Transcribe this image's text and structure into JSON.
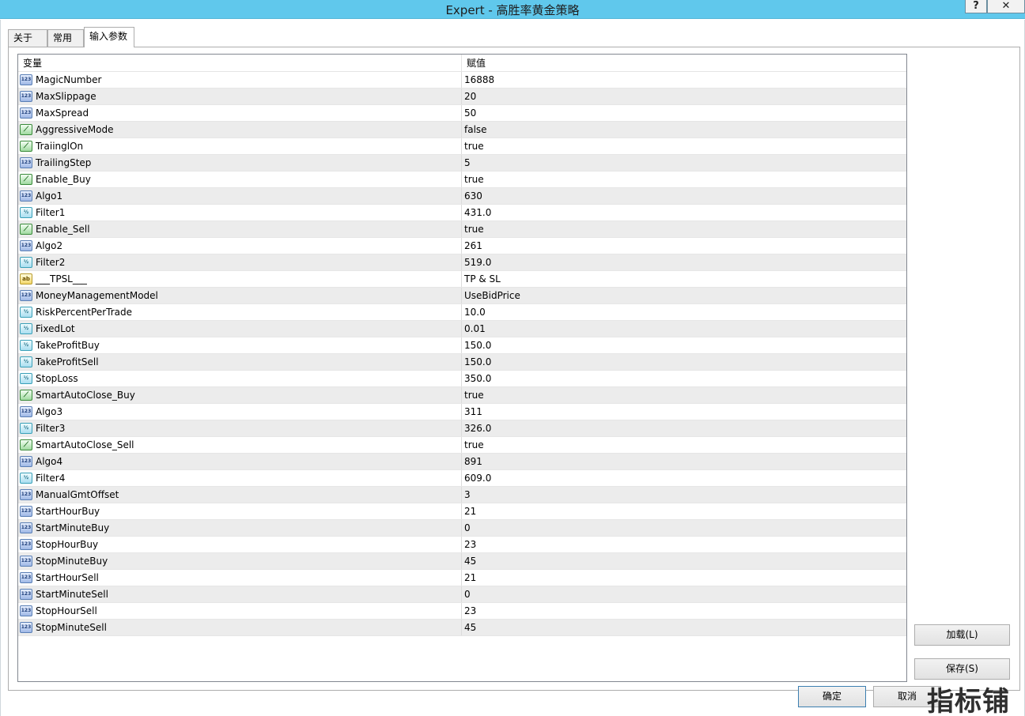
{
  "window": {
    "title": "Expert - 高胜率黄金策略",
    "help_label": "?",
    "close_label": "✕"
  },
  "tabs": [
    {
      "label": "关于"
    },
    {
      "label": "常用"
    },
    {
      "label": "输入参数"
    }
  ],
  "grid": {
    "col_variable": "变量",
    "col_value": "赋值",
    "rows": [
      {
        "type": "int",
        "name": "MagicNumber",
        "value": "16888"
      },
      {
        "type": "int",
        "name": "MaxSlippage",
        "value": "20"
      },
      {
        "type": "int",
        "name": "MaxSpread",
        "value": "50"
      },
      {
        "type": "bool",
        "name": "AggressiveMode",
        "value": "false"
      },
      {
        "type": "bool",
        "name": "TraiinglOn",
        "value": "true"
      },
      {
        "type": "int",
        "name": "TrailingStep",
        "value": "5"
      },
      {
        "type": "bool",
        "name": "Enable_Buy",
        "value": "true"
      },
      {
        "type": "int",
        "name": "Algo1",
        "value": "630"
      },
      {
        "type": "double",
        "name": "Filter1",
        "value": "431.0"
      },
      {
        "type": "bool",
        "name": "Enable_Sell",
        "value": "true"
      },
      {
        "type": "int",
        "name": "Algo2",
        "value": "261"
      },
      {
        "type": "double",
        "name": "Filter2",
        "value": "519.0"
      },
      {
        "type": "string",
        "name": "___TPSL___",
        "value": "TP & SL"
      },
      {
        "type": "int",
        "name": "MoneyManagementModel",
        "value": "UseBidPrice"
      },
      {
        "type": "double",
        "name": "RiskPercentPerTrade",
        "value": "10.0"
      },
      {
        "type": "double",
        "name": "FixedLot",
        "value": "0.01"
      },
      {
        "type": "double",
        "name": "TakeProfitBuy",
        "value": "150.0"
      },
      {
        "type": "double",
        "name": "TakeProfitSell",
        "value": "150.0"
      },
      {
        "type": "double",
        "name": "StopLoss",
        "value": "350.0"
      },
      {
        "type": "bool",
        "name": "SmartAutoClose_Buy",
        "value": "true"
      },
      {
        "type": "int",
        "name": "Algo3",
        "value": "311"
      },
      {
        "type": "double",
        "name": "Filter3",
        "value": "326.0"
      },
      {
        "type": "bool",
        "name": "SmartAutoClose_Sell",
        "value": "true"
      },
      {
        "type": "int",
        "name": "Algo4",
        "value": "891"
      },
      {
        "type": "double",
        "name": "Filter4",
        "value": "609.0"
      },
      {
        "type": "int",
        "name": "ManualGmtOffset",
        "value": "3"
      },
      {
        "type": "int",
        "name": "StartHourBuy",
        "value": "21"
      },
      {
        "type": "int",
        "name": "StartMinuteBuy",
        "value": "0"
      },
      {
        "type": "int",
        "name": "StopHourBuy",
        "value": "23"
      },
      {
        "type": "int",
        "name": "StopMinuteBuy",
        "value": "45"
      },
      {
        "type": "int",
        "name": "StartHourSell",
        "value": "21"
      },
      {
        "type": "int",
        "name": "StartMinuteSell",
        "value": "0"
      },
      {
        "type": "int",
        "name": "StopHourSell",
        "value": "23"
      },
      {
        "type": "int",
        "name": "StopMinuteSell",
        "value": "45"
      }
    ]
  },
  "icons": {
    "int": {
      "name": "integer-type-icon",
      "text": "123"
    },
    "bool": {
      "name": "boolean-type-icon",
      "text": "⟋"
    },
    "double": {
      "name": "double-type-icon",
      "text": "½"
    },
    "string": {
      "name": "string-type-icon",
      "text": "ab"
    }
  },
  "buttons": {
    "load": "加载(L)",
    "save": "保存(S)",
    "ok": "确定",
    "cancel": "取消"
  },
  "watermark": "指标铺"
}
